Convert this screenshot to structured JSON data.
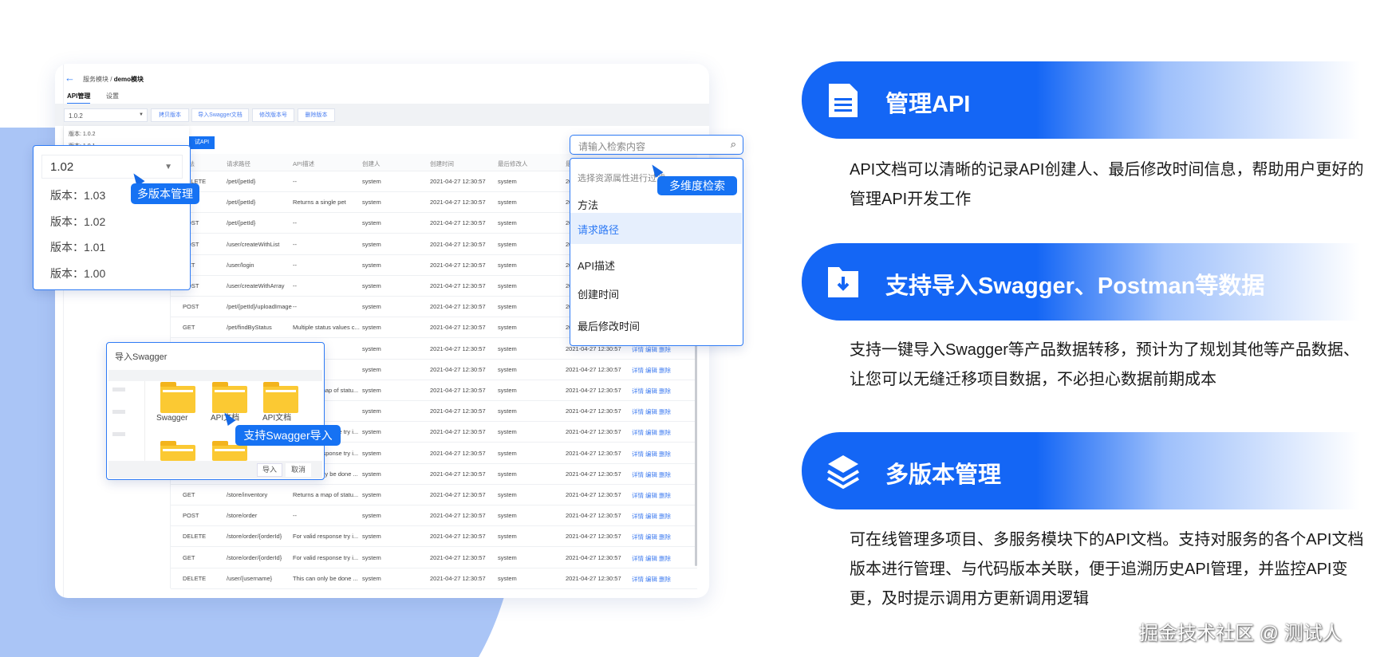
{
  "colors": {
    "accent": "#1672f3",
    "blob": "#aac5f6"
  },
  "mockup": {
    "breadcrumb": {
      "parent": "服务模块",
      "separator": "/",
      "current": "demo模块"
    },
    "tabs": [
      {
        "label": "API管理",
        "active": true
      },
      {
        "label": "设置",
        "active": false
      }
    ],
    "version_select": "1.0.2",
    "toolbar": [
      "拷贝版本",
      "导入Swagger文档",
      "修改版本号",
      "删除版本"
    ],
    "native_options": [
      "版本: 1.0.2",
      "版本: 1.0.1"
    ],
    "new_api_button": "试API",
    "table": {
      "headers": [
        "方法",
        "请求路径",
        "API描述",
        "创建人",
        "创建时间",
        "最后修改人",
        "最后修改时间"
      ],
      "actions": [
        "详情",
        "编辑",
        "删除"
      ],
      "rows": [
        {
          "method": "DELETE",
          "path": "/pet/{petId}",
          "desc": "--",
          "creator": "system",
          "ctime": "2021-04-27 12:30:57",
          "modifier": "system",
          "mtime": "2021-04-27 12:30:57"
        },
        {
          "method": "GET",
          "path": "/pet/{petId}",
          "desc": "Returns a single pet",
          "creator": "system",
          "ctime": "2021-04-27 12:30:57",
          "modifier": "system",
          "mtime": "2021-04-27 12:30:57"
        },
        {
          "method": "POST",
          "path": "/pet/{petId}",
          "desc": "--",
          "creator": "system",
          "ctime": "2021-04-27 12:30:57",
          "modifier": "system",
          "mtime": "2021-04-27 12:30:57"
        },
        {
          "method": "POST",
          "path": "/user/createWithList",
          "desc": "--",
          "creator": "system",
          "ctime": "2021-04-27 12:30:57",
          "modifier": "system",
          "mtime": "2021-04-27 12:30:57"
        },
        {
          "method": "GET",
          "path": "/user/login",
          "desc": "--",
          "creator": "system",
          "ctime": "2021-04-27 12:30:57",
          "modifier": "system",
          "mtime": "2021-04-27 12:30:57"
        },
        {
          "method": "POST",
          "path": "/user/createWithArray",
          "desc": "--",
          "creator": "system",
          "ctime": "2021-04-27 12:30:57",
          "modifier": "system",
          "mtime": "2021-04-27 12:30:57"
        },
        {
          "method": "POST",
          "path": "/pet/{petId}/uploadImage",
          "desc": "--",
          "creator": "system",
          "ctime": "2021-04-27 12:30:57",
          "modifier": "system",
          "mtime": "2021-04-27 12:30:57"
        },
        {
          "method": "GET",
          "path": "/pet/findByStatus",
          "desc": "Multiple status values c...",
          "creator": "system",
          "ctime": "2021-04-27 12:30:57",
          "modifier": "system",
          "mtime": "2021-04-27 12:30:57"
        },
        {
          "method": "",
          "path": "",
          "desc": "",
          "creator": "system",
          "ctime": "2021-04-27 12:30:57",
          "modifier": "system",
          "mtime": "2021-04-27 12:30:57"
        },
        {
          "method": "",
          "path": "",
          "desc": "",
          "creator": "system",
          "ctime": "2021-04-27 12:30:57",
          "modifier": "system",
          "mtime": "2021-04-27 12:30:57"
        },
        {
          "method": "",
          "path": "",
          "desc": "Returns a map of statu...",
          "creator": "system",
          "ctime": "2021-04-27 12:30:57",
          "modifier": "system",
          "mtime": "2021-04-27 12:30:57"
        },
        {
          "method": "",
          "path": "",
          "desc": "",
          "creator": "system",
          "ctime": "2021-04-27 12:30:57",
          "modifier": "system",
          "mtime": "2021-04-27 12:30:57"
        },
        {
          "method": "",
          "path": "",
          "desc": "For valid response try i...",
          "creator": "system",
          "ctime": "2021-04-27 12:30:57",
          "modifier": "system",
          "mtime": "2021-04-27 12:30:57"
        },
        {
          "method": "",
          "path": "",
          "desc": "For valid response try i...",
          "creator": "system",
          "ctime": "2021-04-27 12:30:57",
          "modifier": "system",
          "mtime": "2021-04-27 12:30:57"
        },
        {
          "method": "",
          "path": "",
          "desc": "This can only be done ...",
          "creator": "system",
          "ctime": "2021-04-27 12:30:57",
          "modifier": "system",
          "mtime": "2021-04-27 12:30:57"
        },
        {
          "method": "GET",
          "path": "/store/inventory",
          "desc": "Returns a map of statu...",
          "creator": "system",
          "ctime": "2021-04-27 12:30:57",
          "modifier": "system",
          "mtime": "2021-04-27 12:30:57"
        },
        {
          "method": "POST",
          "path": "/store/order",
          "desc": "--",
          "creator": "system",
          "ctime": "2021-04-27 12:30:57",
          "modifier": "system",
          "mtime": "2021-04-27 12:30:57"
        },
        {
          "method": "DELETE",
          "path": "/store/order/{orderId}",
          "desc": "For valid response try i...",
          "creator": "system",
          "ctime": "2021-04-27 12:30:57",
          "modifier": "system",
          "mtime": "2021-04-27 12:30:57"
        },
        {
          "method": "GET",
          "path": "/store/order/{orderId}",
          "desc": "For valid response try i...",
          "creator": "system",
          "ctime": "2021-04-27 12:30:57",
          "modifier": "system",
          "mtime": "2021-04-27 12:30:57"
        },
        {
          "method": "DELETE",
          "path": "/user/{username}",
          "desc": "This can only be done ...",
          "creator": "system",
          "ctime": "2021-04-27 12:30:57",
          "modifier": "system",
          "mtime": "2021-04-27 12:30:57"
        }
      ]
    },
    "version_dropdown": {
      "selected": "1.02",
      "options": [
        "版本：1.03",
        "版本：1.02",
        "版本：1.01",
        "版本：1.00"
      ],
      "callout": "多版本管理"
    },
    "search": {
      "placeholder": "请输入检索内容",
      "filter_hint": "选择资源属性进行过滤",
      "options": [
        "方法",
        "请求路径",
        "API描述",
        "创建时间",
        "最后修改时间"
      ],
      "selected": "请求路径",
      "callout": "多维度检索"
    },
    "import_dialog": {
      "title": "导入Swagger",
      "folders": [
        "Swagger",
        "API文档",
        "API文档"
      ],
      "import_button": "导入",
      "cancel_button": "取消",
      "callout": "支持Swagger导入"
    }
  },
  "features": [
    {
      "icon": "document-icon",
      "title": "管理API",
      "desc": "API文档可以清晰的记录API创建人、最后修改时间信息，帮助用户更好的管理API开发工作"
    },
    {
      "icon": "folder-download-icon",
      "title": "支持导入Swagger、Postman等数据",
      "desc": "支持一键导入Swagger等产品数据转移，预计为了规划其他等产品数据、让您可以无缝迁移项目数据，不必担心数据前期成本"
    },
    {
      "icon": "layers-icon",
      "title": "多版本管理",
      "desc": "可在线管理多项目、多服务模块下的API文档。支持对服务的各个API文档版本进行管理、与代码版本关联，便于追溯历史API管理，并监控API变更，及时提示调用方更新调用逻辑"
    }
  ],
  "watermark": "掘金技术社区 @ 测试人"
}
